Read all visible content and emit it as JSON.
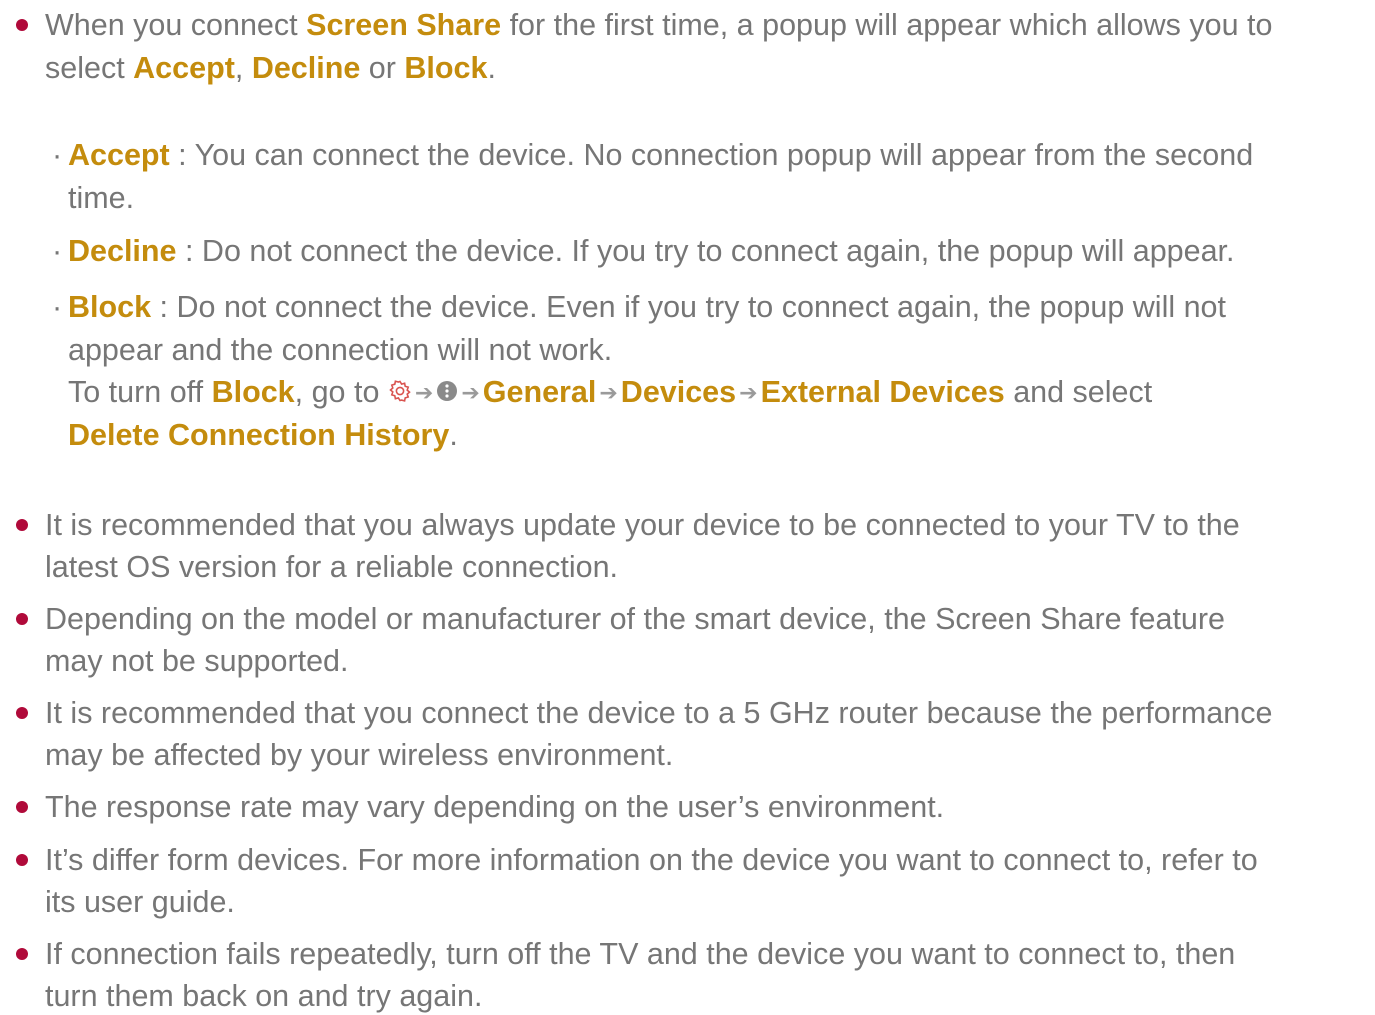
{
  "accent_color": "#c48c0d",
  "bullet_color": "#b00a3a",
  "intro": {
    "line1_pre": "When you connect ",
    "line1_bold": "Screen Share",
    "line1_post": " for the first time, a popup will appear which allows you to",
    "line2_pre": "select ",
    "accept": "Accept",
    "comma": ", ",
    "decline": "Decline",
    "or": " or ",
    "block": "Block",
    "period": "."
  },
  "options": {
    "accept_label": "Accept",
    "accept_line1": " : You can connect the device. No connection popup will appear from the second",
    "accept_line2": "time.",
    "decline_label": "Decline",
    "decline_text": " : Do not connect the device. If you try to connect again, the popup will appear.",
    "block_label": "Block",
    "block_line1": " : Do not connect the device. Even if you try to connect again, the popup will not",
    "block_line2": "appear and the connection will not work.",
    "turnoff_pre": "To turn off ",
    "turnoff_block": "Block",
    "turnoff_goto": ", go to ",
    "arrow": "➔",
    "path_general": "General",
    "path_devices": "Devices",
    "path_external": "External Devices",
    "path_and_select": " and select",
    "delete_history": "Delete Connection History",
    "final_period": ".",
    "icons": [
      "gear-icon",
      "more-options-icon"
    ]
  },
  "notes": [
    {
      "line1": "It is recommended that you always update your device to be connected to your TV to the",
      "line2": "latest OS version for a reliable connection."
    },
    {
      "line1": "Depending on the model or manufacturer of the smart device, the Screen Share feature",
      "line2": "may not be supported."
    },
    {
      "line1": "It is recommended that you connect the device to a 5 GHz router because the performance",
      "line2": "may be affected by your wireless environment."
    },
    {
      "line1": "The response rate may vary depending on the user’s environment.",
      "line2": ""
    },
    {
      "line1": "It’s differ form devices. For more information on the device you want to connect to, refer to",
      "line2": "its user guide."
    },
    {
      "line1": "If connection fails repeatedly, turn off the TV and the device you want to connect to, then",
      "line2": "turn them back on and try again."
    }
  ]
}
